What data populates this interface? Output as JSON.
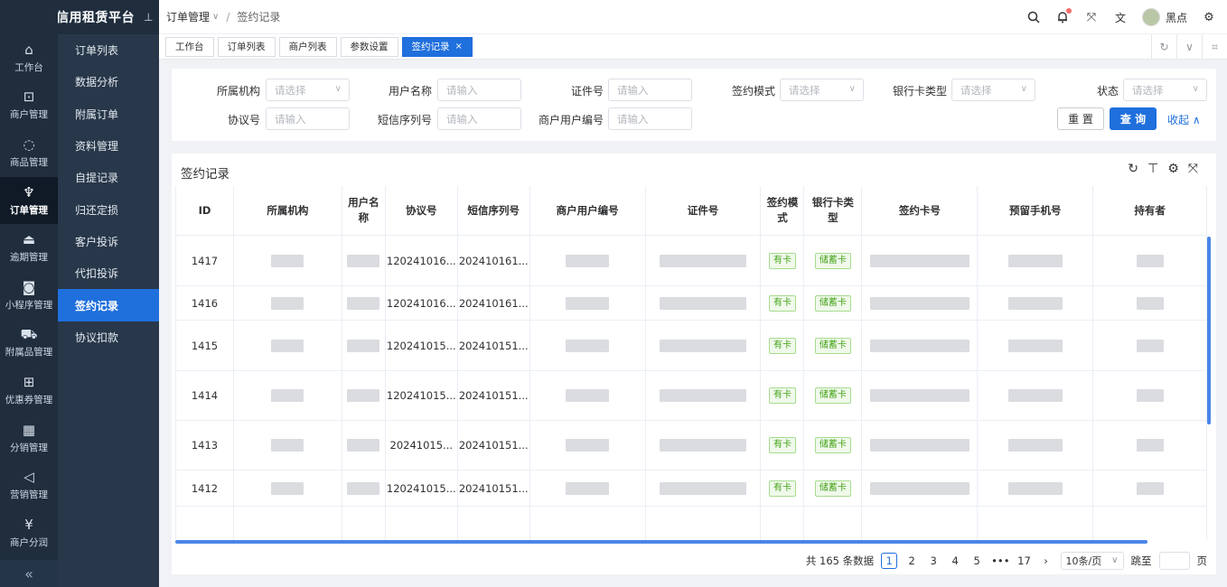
{
  "app": {
    "title": "信用租赁平台"
  },
  "nav": [
    {
      "label": "工作台",
      "icon": "home-icon",
      "glyph": "⌂"
    },
    {
      "label": "商户管理",
      "icon": "bag-icon",
      "glyph": "⊡"
    },
    {
      "label": "商品管理",
      "icon": "apple-icon",
      "glyph": "◌"
    },
    {
      "label": "订单管理",
      "icon": "trophy-icon",
      "glyph": "♆",
      "active": true
    },
    {
      "label": "逾期管理",
      "icon": "alarm-icon",
      "glyph": "⏏"
    },
    {
      "label": "小程序管理",
      "icon": "watch-icon",
      "glyph": "◙"
    },
    {
      "label": "附属品管理",
      "icon": "cart-icon",
      "glyph": "⛟"
    },
    {
      "label": "优惠券管理",
      "icon": "gift-icon",
      "glyph": "⊞"
    },
    {
      "label": "分销管理",
      "icon": "chart-icon",
      "glyph": "▦"
    },
    {
      "label": "营销管理",
      "icon": "megaphone-icon",
      "glyph": "◁"
    },
    {
      "label": "商户分润",
      "icon": "yen-icon",
      "glyph": "¥"
    }
  ],
  "submenu": [
    {
      "label": "订单列表"
    },
    {
      "label": "数据分析"
    },
    {
      "label": "附属订单"
    },
    {
      "label": "资料管理"
    },
    {
      "label": "自提记录"
    },
    {
      "label": "归还定损"
    },
    {
      "label": "客户投诉"
    },
    {
      "label": "代扣投诉"
    },
    {
      "label": "签约记录",
      "active": true
    },
    {
      "label": "协议扣款"
    }
  ],
  "breadcrumb": {
    "parent": "订单管理",
    "current": "签约记录"
  },
  "header": {
    "username": "黑点"
  },
  "tabs": [
    {
      "label": "工作台"
    },
    {
      "label": "订单列表"
    },
    {
      "label": "商户列表"
    },
    {
      "label": "参数设置"
    },
    {
      "label": "签约记录",
      "active": true
    }
  ],
  "filters": {
    "org_label": "所属机构",
    "org_placeholder": "请选择",
    "user_label": "用户名称",
    "user_placeholder": "请输入",
    "idno_label": "证件号",
    "idno_placeholder": "请输入",
    "mode_label": "签约模式",
    "mode_placeholder": "请选择",
    "card_label": "银行卡类型",
    "card_placeholder": "请选择",
    "status_label": "状态",
    "status_placeholder": "请选择",
    "agree_label": "协议号",
    "agree_placeholder": "请输入",
    "sms_label": "短信序列号",
    "sms_placeholder": "请输入",
    "merchant_user_label": "商户用户编号",
    "merchant_user_placeholder": "请输入",
    "reset": "重 置",
    "query": "查 询",
    "collapse": "收起"
  },
  "table": {
    "title": "签约记录",
    "columns": [
      "ID",
      "所属机构",
      "用户名称",
      "协议号",
      "短信序列号",
      "商户用户编号",
      "证件号",
      "签约模式",
      "银行卡类型",
      "签约卡号",
      "预留手机号",
      "持有者"
    ],
    "rows": [
      {
        "id": "1417",
        "agreement": "120241016...",
        "sms": "202410161...",
        "mode": "有卡",
        "card": "储蓄卡"
      },
      {
        "id": "1416",
        "agreement": "120241016...",
        "sms": "202410161...",
        "mode": "有卡",
        "card": "储蓄卡"
      },
      {
        "id": "1415",
        "agreement": "120241015...",
        "sms": "202410151...",
        "mode": "有卡",
        "card": "储蓄卡"
      },
      {
        "id": "1414",
        "agreement": "120241015...",
        "sms": "202410151...",
        "mode": "有卡",
        "card": "储蓄卡"
      },
      {
        "id": "1413",
        "agreement": "20241015...",
        "sms": "202410151...",
        "mode": "有卡",
        "card": "储蓄卡"
      },
      {
        "id": "1412",
        "agreement": "120241015...",
        "sms": "202410151...",
        "mode": "有卡",
        "card": "储蓄卡"
      }
    ]
  },
  "pager": {
    "total": "共 165 条数据",
    "pages": [
      "1",
      "2",
      "3",
      "4",
      "5",
      "•••",
      "17"
    ],
    "page_size": "10条/页",
    "goto": "跳至",
    "page_unit": "页"
  }
}
